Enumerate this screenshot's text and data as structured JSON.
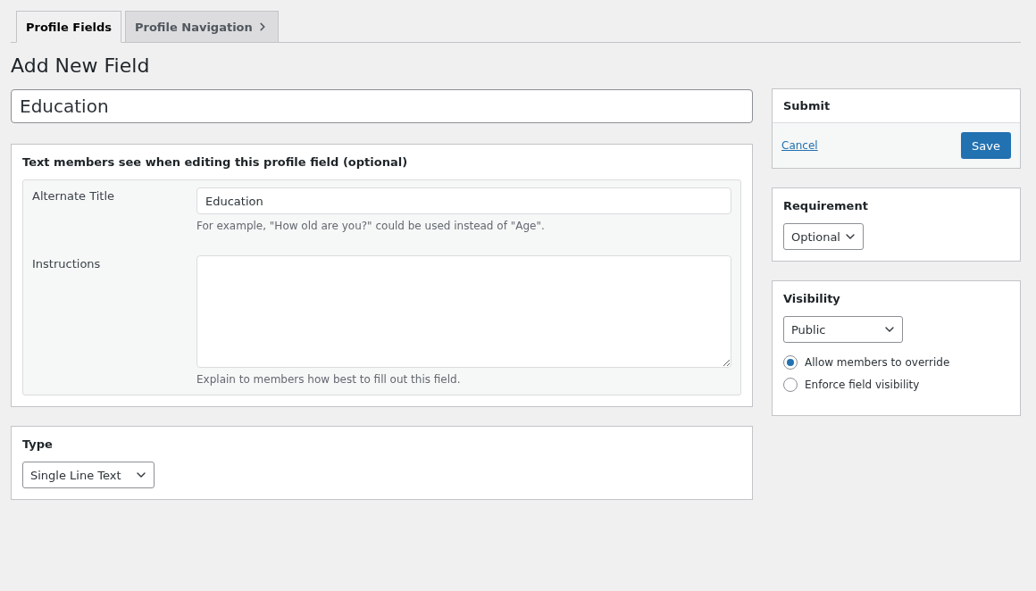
{
  "tabs": [
    {
      "label": "Profile Fields",
      "selected": true,
      "chevron": false
    },
    {
      "label": "Profile Navigation",
      "selected": false,
      "chevron": true
    }
  ],
  "heading": "Add New Field",
  "field_name": {
    "value": "Education"
  },
  "texts_box": {
    "title": "Text members see when editing this profile field (optional)",
    "rows": [
      {
        "kind": "input",
        "label": "Alternate Title",
        "value": "Education",
        "hint": "For example, \"How old are you?\" could be used instead of \"Age\"."
      },
      {
        "kind": "textarea",
        "label": "Instructions",
        "value": "",
        "hint": "Explain to members how best to fill out this field."
      }
    ]
  },
  "type_box": {
    "title": "Type",
    "select": "Single Line Text"
  },
  "submit_box": {
    "title": "Submit",
    "cancel": "Cancel",
    "save": "Save"
  },
  "requirement_box": {
    "title": "Requirement",
    "select": "Optional"
  },
  "visibility_box": {
    "title": "Visibility",
    "select": "Public",
    "options": [
      {
        "label": "Allow members to override",
        "selected": true
      },
      {
        "label": "Enforce field visibility",
        "selected": false
      }
    ]
  }
}
